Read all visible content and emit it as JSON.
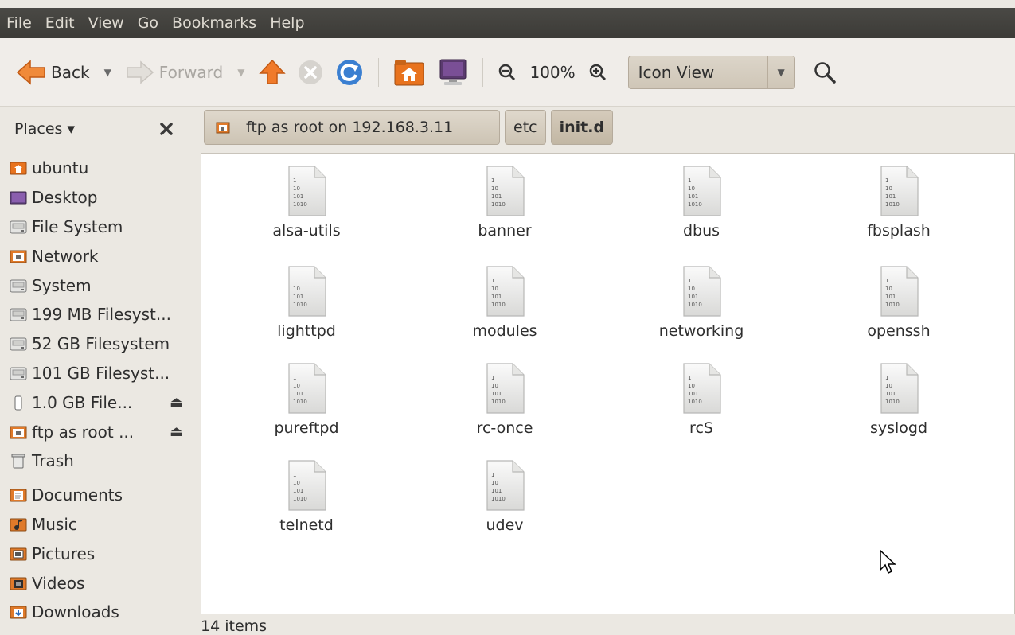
{
  "menubar": {
    "items": [
      "File",
      "Edit",
      "View",
      "Go",
      "Bookmarks",
      "Help"
    ]
  },
  "toolbar": {
    "back_label": "Back",
    "forward_label": "Forward",
    "zoom_level": "100%",
    "view_mode": "Icon View"
  },
  "places": {
    "header": "Places ▾",
    "items": [
      {
        "label": "ubuntu",
        "icon": "home-folder-icon"
      },
      {
        "label": "Desktop",
        "icon": "desktop-icon"
      },
      {
        "label": "File System",
        "icon": "drive-icon"
      },
      {
        "label": "Network",
        "icon": "network-folder-icon"
      },
      {
        "label": "System",
        "icon": "drive-icon"
      },
      {
        "label": "199 MB Filesyst...",
        "icon": "drive-icon"
      },
      {
        "label": "52 GB Filesystem",
        "icon": "drive-icon"
      },
      {
        "label": "101 GB Filesyst...",
        "icon": "drive-icon"
      },
      {
        "label": "1.0 GB File...",
        "icon": "usb-drive-icon",
        "eject": true
      },
      {
        "label": "ftp as root ...",
        "icon": "network-folder-icon",
        "eject": true
      },
      {
        "label": "Trash",
        "icon": "trash-icon"
      }
    ],
    "bookmarks": [
      {
        "label": "Documents",
        "icon": "documents-folder-icon"
      },
      {
        "label": "Music",
        "icon": "music-folder-icon"
      },
      {
        "label": "Pictures",
        "icon": "pictures-folder-icon"
      },
      {
        "label": "Videos",
        "icon": "videos-folder-icon"
      },
      {
        "label": "Downloads",
        "icon": "downloads-folder-icon"
      }
    ]
  },
  "pathbar": {
    "crumbs": [
      "ftp as root on 192.168.3.11",
      "etc",
      "init.d"
    ]
  },
  "files": [
    "alsa-utils",
    "banner",
    "dbus",
    "fbsplash",
    "lighttpd",
    "modules",
    "networking",
    "openssh",
    "pureftpd",
    "rc-once",
    "rcS",
    "syslogd",
    "telnetd",
    "udev"
  ],
  "file_icon_text": [
    "1",
    "10",
    "101",
    "1010"
  ],
  "status": "14 items",
  "colors": {
    "menubar_bg": "#3c3b37",
    "window_bg": "#ebe8e2",
    "accent_orange": "#e8731e"
  }
}
